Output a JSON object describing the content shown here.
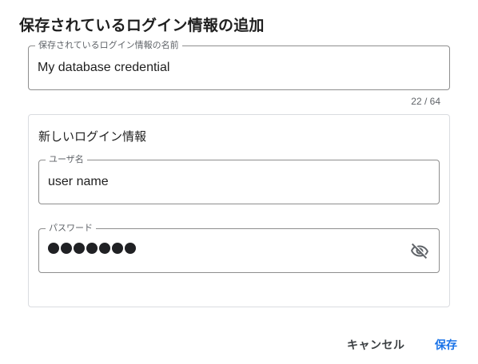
{
  "dialog": {
    "title": "保存されているログイン情報の追加",
    "name_field": {
      "label": "保存されているログイン情報の名前",
      "value": "My database credential",
      "counter": "22 / 64"
    },
    "credential": {
      "title": "新しいログイン情報",
      "username": {
        "label": "ユーザ名",
        "value": "user name"
      },
      "password": {
        "label": "パスワード",
        "masked_length": 7,
        "visibility_icon": "visibility-off-icon"
      }
    },
    "actions": {
      "cancel_label": "キャンセル",
      "save_label": "保存"
    }
  },
  "colors": {
    "accent": "#1a73e8",
    "border": "#8e8e8e",
    "card_border": "#dadce0",
    "label": "#5f6368"
  }
}
